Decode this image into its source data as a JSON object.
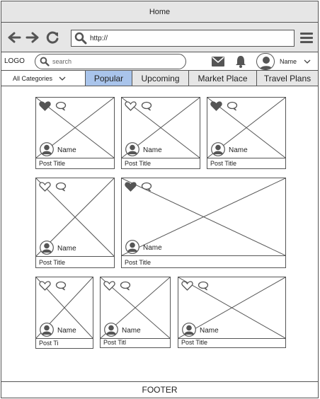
{
  "window": {
    "title": "Home"
  },
  "browser": {
    "url": "http://",
    "icons": [
      "back-arrow-icon",
      "forward-arrow-icon",
      "refresh-icon",
      "search-icon",
      "hamburger-menu-icon"
    ]
  },
  "header": {
    "logo": "LOGO",
    "search_placeholder": "search",
    "user_name": "Name",
    "icons": [
      "mail-icon",
      "bell-icon",
      "user-avatar-icon",
      "chevron-down-icon"
    ]
  },
  "tabs": {
    "category_label": "All Categories",
    "items": [
      {
        "label": "Popular",
        "active": true
      },
      {
        "label": "Upcoming",
        "active": false
      },
      {
        "label": "Market Place",
        "active": false
      },
      {
        "label": "Travel Plans",
        "active": false
      }
    ]
  },
  "colors": {
    "active_tab": "#a9c4eb",
    "chrome": "#e6e6e6",
    "border": "#555555"
  },
  "cards": [
    {
      "author": "Name",
      "title": "Post Title",
      "liked": true
    },
    {
      "author": "Name",
      "title": "Post Title",
      "liked": false
    },
    {
      "author": "Name",
      "title": "Post Title",
      "liked": true
    },
    {
      "author": "Name",
      "title": "Post Title",
      "liked": false
    },
    {
      "author": "Name",
      "title": "Post Title",
      "liked": true
    },
    {
      "author": "Name",
      "title": "Post Ti",
      "liked": false
    },
    {
      "author": "Name",
      "title": "Post Titl",
      "liked": false
    },
    {
      "author": "Name",
      "title": "Post Title",
      "liked": false
    }
  ],
  "footer": {
    "label": "FOOTER"
  }
}
